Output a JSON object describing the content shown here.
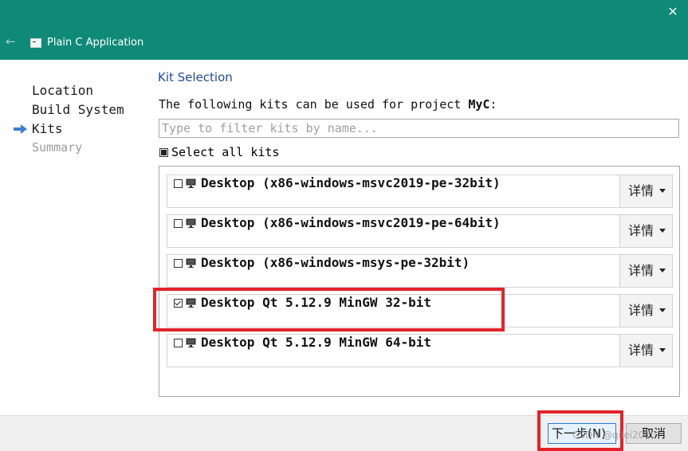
{
  "window": {
    "title": "Plain C Application",
    "close_icon": "close-icon",
    "back_icon": "back-arrow-icon",
    "accent_color": "#108a78"
  },
  "steps": [
    {
      "label": "Location",
      "state": "done"
    },
    {
      "label": "Build System",
      "state": "done"
    },
    {
      "label": "Kits",
      "state": "current"
    },
    {
      "label": "Summary",
      "state": "disabled"
    }
  ],
  "page": {
    "heading": "Kit Selection",
    "intro_prefix": "The following kits can be used for project ",
    "project_name": "MyC",
    "intro_suffix": ":"
  },
  "filter": {
    "placeholder": "Type to filter kits by name...",
    "value": ""
  },
  "select_all": {
    "label": "Select all kits",
    "state": "partial"
  },
  "kits": [
    {
      "name": "Desktop (x86-windows-msvc2019-pe-32bit)",
      "checked": false,
      "details_label": "详情"
    },
    {
      "name": "Desktop (x86-windows-msvc2019-pe-64bit)",
      "checked": false,
      "details_label": "详情"
    },
    {
      "name": "Desktop (x86-windows-msys-pe-32bit)",
      "checked": false,
      "details_label": "详情"
    },
    {
      "name": "Desktop Qt 5.12.9 MinGW 32-bit",
      "checked": true,
      "details_label": "详情"
    },
    {
      "name": "Desktop Qt 5.12.9 MinGW 64-bit",
      "checked": false,
      "details_label": "详情"
    }
  ],
  "footer": {
    "next_label": "下一步(N)",
    "cancel_label": "取消",
    "watermark": "CSDN @qilei2010"
  },
  "annotation_color": "#e2232a"
}
